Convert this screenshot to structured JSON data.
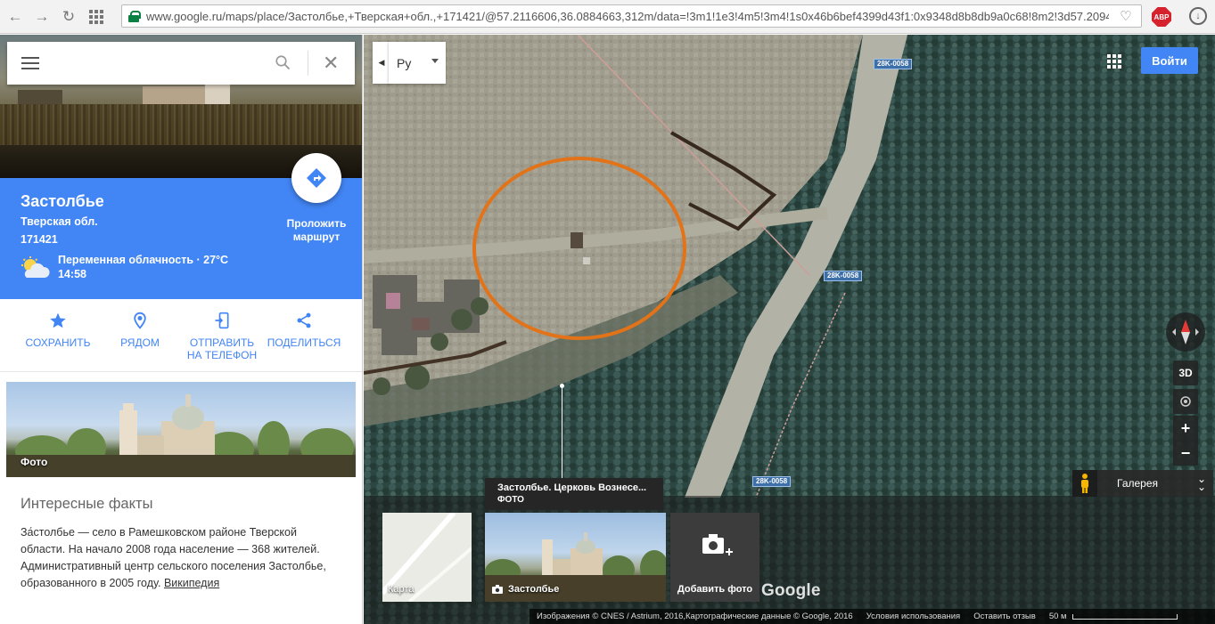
{
  "browser": {
    "url": "www.google.ru/maps/place/Застолбье,+Тверская+обл.,+171421/@57.2116606,36.0884663,312m/data=!3m1!1e3!4m5!3m4!1s0x46b6bef4399d43f1:0x9348d8b8db9a0c68!8m2!3d57.2094",
    "adblock_label": "ABP"
  },
  "search": {
    "placeholder": ""
  },
  "place": {
    "title": "Застолбье",
    "region": "Тверская обл.",
    "postal_code": "171421",
    "weather": "Переменная облачность · 27°C",
    "time": "14:58",
    "route_label": "Проложить маршрут"
  },
  "actions": [
    {
      "label": "СОХРАНИТЬ",
      "icon": "star-icon"
    },
    {
      "label": "РЯДОМ",
      "icon": "nearby-icon"
    },
    {
      "label": "ОТПРАВИТЬ НА ТЕЛЕФОН",
      "icon": "send-to-phone-icon"
    },
    {
      "label": "ПОДЕЛИТЬСЯ",
      "icon": "share-icon"
    }
  ],
  "photo": {
    "label": "Фото"
  },
  "facts": {
    "title": "Интересные факты",
    "text": "За́столбье — село в Рамешковском районе Тверской области. На начало 2008 года население — 368 жителей. Административный центр сельского поселения Застолбье, образованного в 2005 году.",
    "link": "Википедия"
  },
  "map": {
    "language": "Ру",
    "signin_label": "Войти",
    "road_labels": [
      "28K-0058",
      "28K-0058",
      "28K-0058"
    ],
    "btn_3d": "3D",
    "zoom_in": "+",
    "zoom_out": "−",
    "gallery_label": "Галерея",
    "thumb_map_label": "Карта",
    "thumb_photo_label": "Застолбье",
    "add_photo_label": "Добавить фото",
    "tooltip_title": "Застолбье. Церковь Вознесе...",
    "tooltip_sub": "ФОТО",
    "google_logo": "Google",
    "attribution": "Изображения © CNES / Astrium, 2016,Картографические данные © Google, 2016",
    "terms": "Условия использования",
    "feedback": "Оставить отзыв",
    "scale": "50 м"
  },
  "colors": {
    "accent": "#4285f4",
    "highlight_circle": "#f07a1a"
  }
}
